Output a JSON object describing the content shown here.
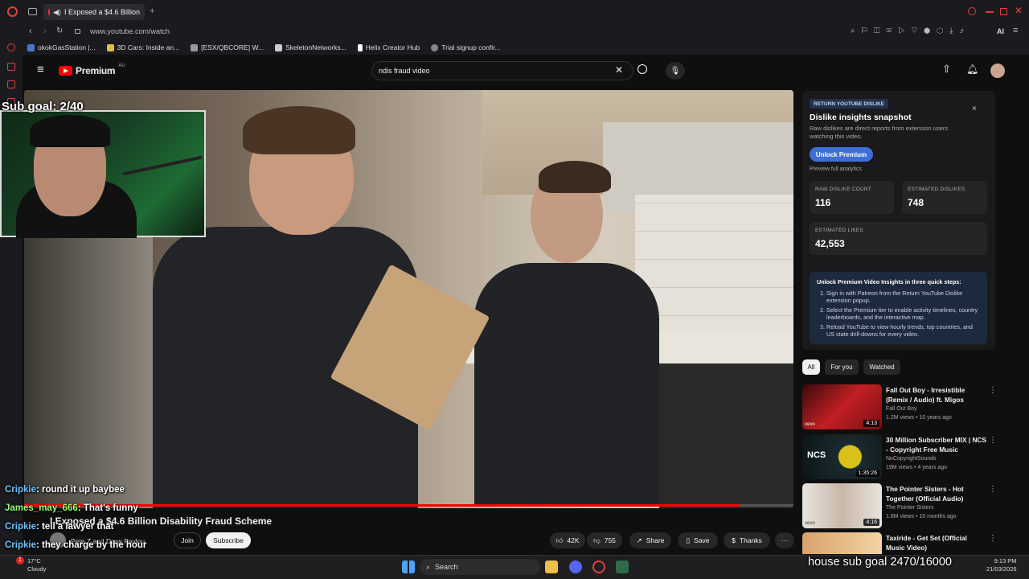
{
  "browser": {
    "tab_title": "I Exposed a $4.6 Billion",
    "new_tab": "+",
    "url": "www.youtube.com/watch",
    "ai_label": "AI",
    "bookmarks": [
      "okokGasStation |...",
      "3D Cars: Inside an...",
      "[ESX/QBCORE] W...",
      "SkeletonNetworks...",
      "Helix Creator Hub",
      "Trial signup confir..."
    ]
  },
  "youtube": {
    "logo_text": "Premium",
    "logo_super": "AU",
    "search_value": "ndis fraud video"
  },
  "video": {
    "title": "I Exposed a $4.6 Billion Disability Fraud Scheme",
    "channel_line": "Pete Z and Drew Pavlou",
    "join": "Join",
    "subscribe": "Subscribe",
    "likes": "42K",
    "dislikes": "755",
    "share": "Share",
    "save": "Save",
    "thanks": "Thanks",
    "more": "···",
    "progress": 0.93
  },
  "overlay": {
    "sub_goal": "Sub goal: 2/40",
    "house_goal": "house sub goal 2470/16000",
    "chat": [
      {
        "user": "Cripkie",
        "msg": ": round it up baybee",
        "color": "u1"
      },
      {
        "user": "James_may_666",
        "msg": ": That's funny",
        "color": "u2"
      },
      {
        "user": "Cripkie",
        "msg": ": tell a lawyer that",
        "color": "u1"
      },
      {
        "user": "Cripkie",
        "msg": ": they charge by the hour",
        "color": "u1"
      }
    ]
  },
  "rydpanel": {
    "badge": "RETURN YOUTUBE DISLIKE",
    "close": "×",
    "title": "Dislike insights snapshot",
    "desc": "Raw dislikes are direct reports from extension users watching this video.",
    "unlock": "Unlock Premium",
    "preview": "Preview full analytics",
    "raw_label": "RAW DISLIKE COUNT",
    "raw_value": "116",
    "est_dis_label": "ESTIMATED DISLIKES",
    "est_dis_value": "748",
    "est_likes_label": "ESTIMATED LIKES",
    "est_likes_value": "42,553",
    "steps_heading": "Unlock Premium Video Insights in three quick steps:",
    "steps": [
      "Sign in with Patreon from the Return YouTube Dislike extension popup.",
      "Select the Premium tier to enable activity timelines, country leaderboards, and the interactive map.",
      "Reload YouTube to view hourly trends, top countries, and US state drill-downs for every video."
    ]
  },
  "chips": [
    "All",
    "For you",
    "Watched"
  ],
  "recommendations": [
    {
      "title": "Fall Out Boy - Irresistible (Remix / Audio) ft. Migos",
      "channel": "Fall Out Boy",
      "meta": "1.2M views • 10 years ago",
      "duration": "4:13",
      "tag": "vevo"
    },
    {
      "title": "30 Million Subscriber MIX | NCS - Copyright Free Music",
      "channel": "NoCopyrightSounds",
      "meta": "19M views • 4 years ago",
      "duration": "1:35:26",
      "tag": "NCS"
    },
    {
      "title": "The Pointer Sisters - Hot Together (Official Audio)",
      "channel": "The Pointer Sisters",
      "meta": "1.8M views • 10 months ago",
      "duration": "4:16",
      "tag": "vevo"
    },
    {
      "title": "Taxiride - Get Set (Official Music Video)",
      "channel": "",
      "meta": "",
      "duration": "",
      "tag": ""
    }
  ],
  "taskbar": {
    "temp": "17°C",
    "weather": "Cloudy",
    "search": "Search",
    "time": "9:13 PM",
    "date": "21/03/2026",
    "notif": "1"
  },
  "colors": {
    "accent": "#3e6fd8",
    "yt_red": "#ff0000",
    "opera_red": "#e0413e"
  }
}
